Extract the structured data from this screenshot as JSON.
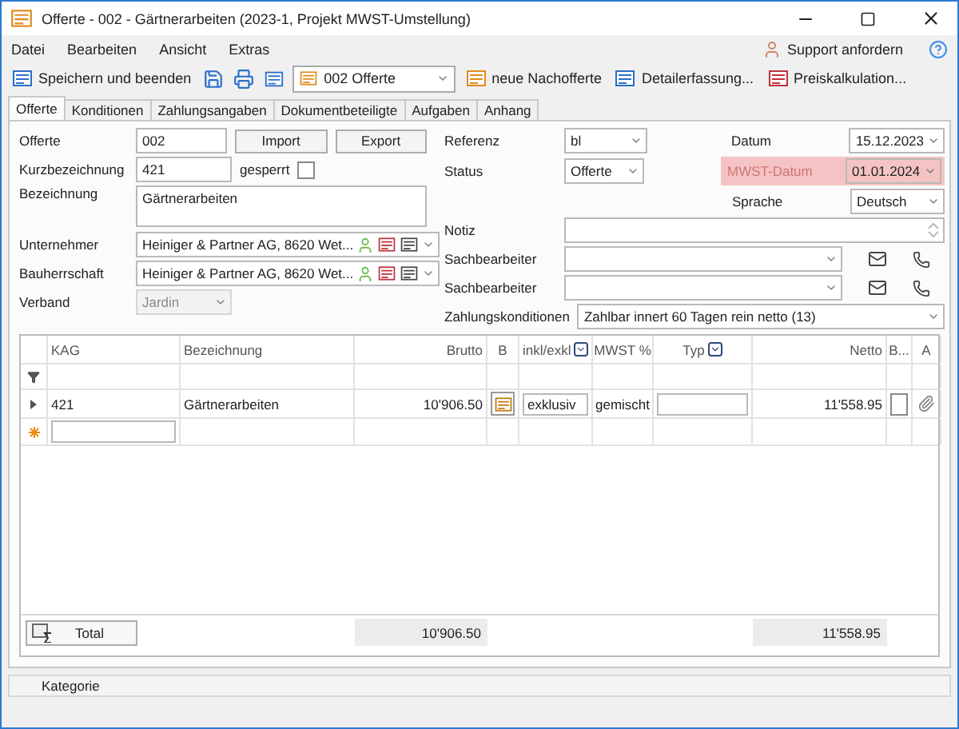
{
  "window": {
    "title": "Offerte - 002 - Gärtnerarbeiten (2023-1, Projekt MWST-Umstellung)"
  },
  "menu": [
    "Datei",
    "Bearbeiten",
    "Ansicht",
    "Extras"
  ],
  "support": "Support anfordern",
  "toolbar": {
    "save_close": "Speichern und beenden",
    "document": "002 Offerte",
    "actions": [
      "neue Nachofferte",
      "Detailerfassung...",
      "Preiskalkulation..."
    ]
  },
  "tabs": [
    {
      "label": "Offerte",
      "selected": true
    },
    {
      "label": "Konditionen",
      "selected": false
    },
    {
      "label": "Zahlungsangaben",
      "selected": false
    },
    {
      "label": "Dokumentbeteiligte",
      "selected": false
    },
    {
      "label": "Aufgaben",
      "selected": false
    },
    {
      "label": "Anhang",
      "selected": false
    }
  ],
  "form": {
    "offerte": {
      "label": "Offerte",
      "value": "002"
    },
    "import": "Import",
    "export": "Export",
    "kurzbezeichnung": {
      "label": "Kurzbezeichnung",
      "value": "421"
    },
    "gesperrt": {
      "label": "gesperrt",
      "checked": false
    },
    "bezeichnung": {
      "label": "Bezeichnung",
      "value": "Gärtnerarbeiten"
    },
    "parties": [
      {
        "label": "Unternehmer",
        "value": "Heiniger & Partner AG, 8620 Wet..."
      },
      {
        "label": "Bauherrschaft",
        "value": "Heiniger & Partner AG, 8620 Wet..."
      }
    ],
    "verband": {
      "label": "Verband",
      "value": "Jardin",
      "disabled": true
    },
    "referenz": {
      "label": "Referenz",
      "value": "bl"
    },
    "status": {
      "label": "Status",
      "value": "Offerte"
    },
    "datum": {
      "label": "Datum",
      "value": "15.12.2023"
    },
    "mwst_datum": {
      "label": "MWST-Datum",
      "value": "01.01.2024",
      "highlighted": true
    },
    "sprache": {
      "label": "Sprache",
      "value": "Deutsch"
    },
    "notiz": {
      "label": "Notiz"
    },
    "sachbearbeiter": [
      {
        "label": "Sachbearbeiter"
      },
      {
        "label": "Sachbearbeiter"
      }
    ],
    "zahlungskonditionen": {
      "label": "Zahlungskonditionen",
      "value": "Zahlbar innert 60 Tagen rein netto (13)"
    }
  },
  "table": {
    "columns": [
      {
        "label": "KAG",
        "kind": "text"
      },
      {
        "label": "Bezeichnung",
        "kind": "text"
      },
      {
        "label": "Brutto",
        "kind": "number"
      },
      {
        "label": "B",
        "kind": "button"
      },
      {
        "label": "inkl/exkl",
        "kind": "combo"
      },
      {
        "label": "MWST %",
        "kind": "center"
      },
      {
        "label": "Typ",
        "kind": "combo"
      },
      {
        "label": "Netto",
        "kind": "number"
      },
      {
        "label": "B...",
        "kind": "check"
      },
      {
        "label": "A",
        "kind": "attach"
      }
    ],
    "rows": [
      {
        "checked": false,
        "cells": [
          "421",
          "Gärtnerarbeiten",
          "10'906.50",
          "",
          "exklusiv",
          "gemischt",
          "",
          "11'558.95",
          "",
          ""
        ]
      }
    ],
    "total": {
      "label": "Total",
      "brutto": "10'906.50",
      "netto": "11'558.95"
    }
  },
  "footer": {
    "label": "Kategorie"
  }
}
